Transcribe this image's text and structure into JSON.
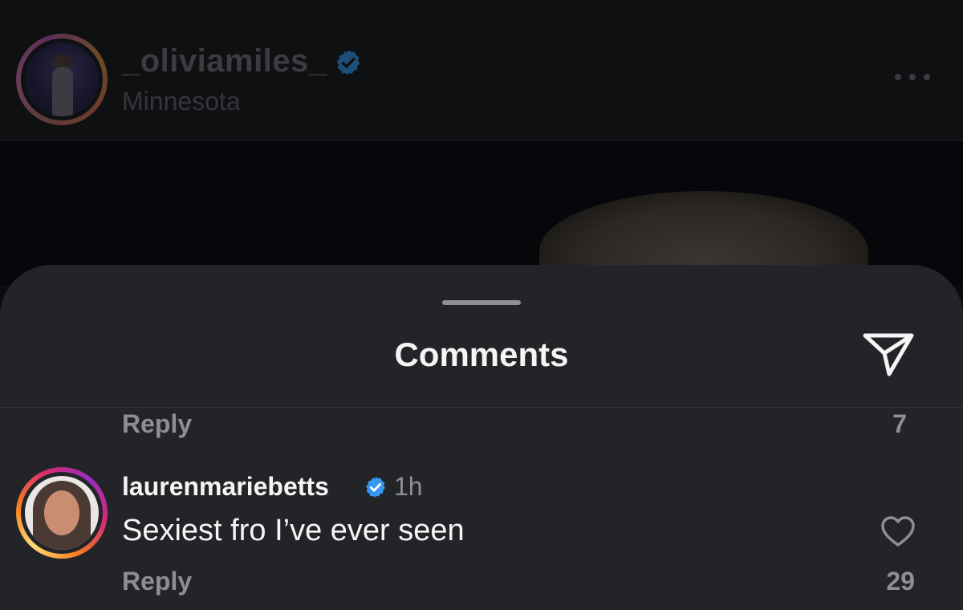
{
  "post": {
    "username": "_oliviamiles_",
    "location": "Minnesota",
    "verified_icon": "verified-badge-icon",
    "more_icon": "more-dots-icon"
  },
  "sheet": {
    "title": "Comments",
    "share_icon": "send-icon"
  },
  "comments": [
    {
      "reply_label": "Reply",
      "like_count": "7"
    },
    {
      "username": "laurenmariebetts",
      "time": "1h",
      "text": "Sexiest fro I’ve ever seen",
      "reply_label": "Reply",
      "like_count": "29",
      "like_icon": "heart-icon"
    }
  ],
  "colors": {
    "background": "#0b0c0e",
    "sheet": "#232428",
    "text_primary": "#f5f5f5",
    "text_secondary": "#8e8f94",
    "verified_blue": "#3897f0"
  }
}
